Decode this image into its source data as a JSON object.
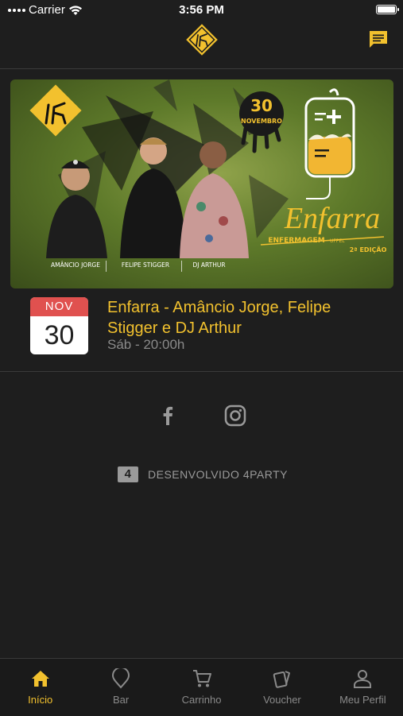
{
  "status_bar": {
    "carrier": "Carrier",
    "time": "3:56 PM"
  },
  "colors": {
    "accent": "#f2c12e",
    "background": "#1e1e1e",
    "inactive": "#8a8a8a",
    "date_month_bg": "#e0514f"
  },
  "banner": {
    "date_day": "30",
    "date_month": "NOVEMBRO",
    "event_name": "Enfarra",
    "subtitle": "ENFERMAGEM",
    "subtitle_small": "UFPEL",
    "edition": "2ª EDIÇÃO",
    "artists": [
      "AMÂNCIO JORGE",
      "FELIPE STIGGER",
      "DJ ARTHUR"
    ]
  },
  "event": {
    "month": "NOV",
    "day": "30",
    "title": "Enfarra - Amâncio Jorge, Felipe Stigger e DJ Arthur",
    "time": "Sáb - 20:00h"
  },
  "footer": {
    "badge": "4",
    "credit": "DESENVOLVIDO 4PARTY"
  },
  "tabs": [
    {
      "label": "Início",
      "icon": "home-icon",
      "active": true
    },
    {
      "label": "Bar",
      "icon": "tag-icon",
      "active": false
    },
    {
      "label": "Carrinho",
      "icon": "cart-icon",
      "active": false
    },
    {
      "label": "Voucher",
      "icon": "ticket-icon",
      "active": false
    },
    {
      "label": "Meu Perfil",
      "icon": "user-icon",
      "active": false
    }
  ]
}
